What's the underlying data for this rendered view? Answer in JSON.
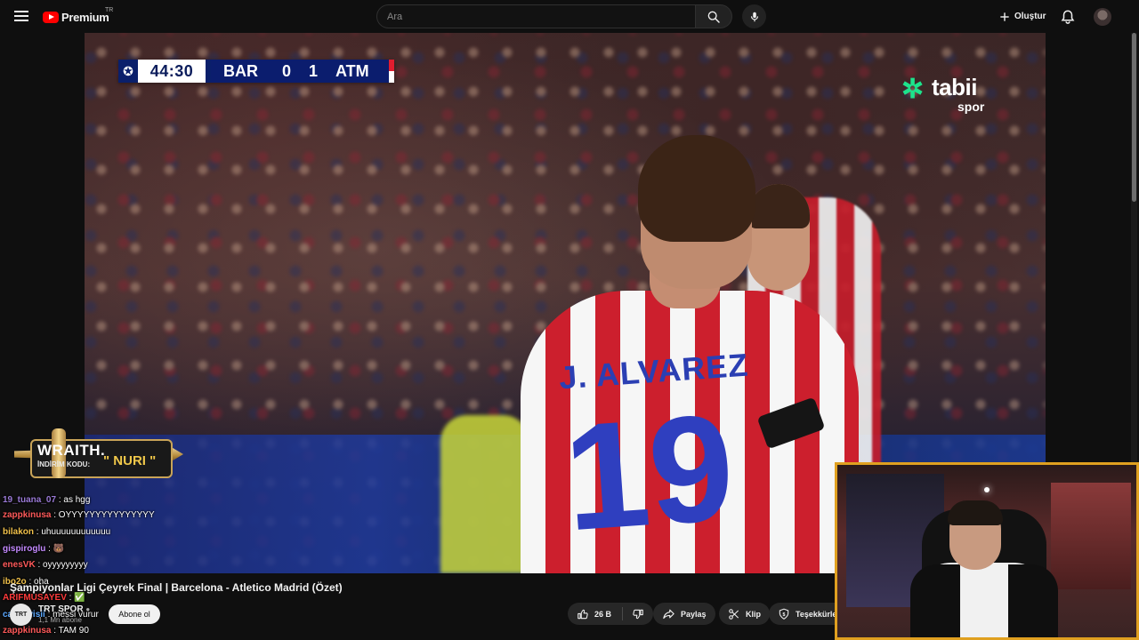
{
  "header": {
    "logo_text": "Premium",
    "logo_country": "TR",
    "search_placeholder": "Ara",
    "create_label": "Oluştur"
  },
  "video": {
    "scorebug": {
      "time": "44:30",
      "home_team": "BAR",
      "home_score": "0",
      "away_score": "1",
      "away_team": "ATM"
    },
    "broadcaster": {
      "name": "tabii",
      "sub": "spor"
    },
    "player_name": "J. ALVAREZ",
    "player_number": "19"
  },
  "sponsor": {
    "brand": "WRAITH.",
    "code_label": "İNDİRİM KODU:",
    "code": "\" NURI \""
  },
  "chat": {
    "messages": [
      {
        "user": "19_tuana_07",
        "text": " : as hgg",
        "color": "#9a7ad6"
      },
      {
        "user": "zappkinusa",
        "text": " : OYYYYYYYYYYYYYYY",
        "color": "#ff5a5a"
      },
      {
        "user": "bilakon",
        "text": " : uhuuuuuuuuuuuu",
        "color": "#f0c04a"
      },
      {
        "user": "gispiroglu",
        "text": " : 🐻",
        "color": "#c48aff"
      },
      {
        "user": "enesVK",
        "text": " : oyyyyyyyyy",
        "color": "#ff5a5a"
      },
      {
        "user": "ibo2o",
        "text": " : oha",
        "color": "#f0c04a"
      },
      {
        "user": "ARIFMUSAYEV",
        "text": " : ✅",
        "color": "#ff3b3b"
      },
      {
        "user": "canaevisii",
        "text": " : messi vurur",
        "color": "#5aa8ff"
      },
      {
        "user": "zappkinusa",
        "text": " : TAM 90",
        "color": "#ff5a5a"
      }
    ]
  },
  "title": {
    "text": "Şampiyonlar Ligi Çeyrek Final | Barcelona - Atletico Madrid (Özet)"
  },
  "channel": {
    "avatar_text": "TRT",
    "name": "TRT SPOR",
    "subscribers": "1,1 Mn abone",
    "subscribe_label": "Abone ol"
  },
  "actions": {
    "like_count": "26 B",
    "share_label": "Paylaş",
    "clip_label": "Klip",
    "thanks_label": "Teşekkürler"
  },
  "colors": {
    "brand_red": "#ff0000",
    "webcam_border": "#e0a020",
    "tabii_green": "#1de38c"
  },
  "icons": [
    "menu-icon",
    "youtube-logo-icon",
    "search-icon",
    "mic-icon",
    "plus-icon",
    "bell-icon",
    "like-icon",
    "dislike-icon",
    "share-icon",
    "scissors-icon",
    "thanks-icon",
    "ucl-ball-icon",
    "verified-icon"
  ]
}
